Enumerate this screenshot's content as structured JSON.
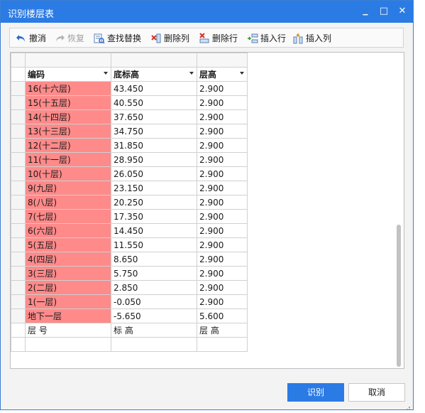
{
  "window": {
    "title": "识别楼层表",
    "minimize_glyph": "▁",
    "maximize_glyph": "□",
    "close_glyph": "✕"
  },
  "toolbar": {
    "undo": "撤消",
    "redo": "恢复",
    "find_replace": "查找替换",
    "delete_col": "删除列",
    "delete_row": "删除行",
    "insert_row": "插入行",
    "insert_col": "插入列"
  },
  "grid": {
    "headers": [
      "编码",
      "底标高",
      "层高"
    ],
    "rows": [
      {
        "code": "16(十六层)",
        "elev": "43.450",
        "height": "2.900"
      },
      {
        "code": "15(十五层)",
        "elev": "40.550",
        "height": "2.900"
      },
      {
        "code": "14(十四层)",
        "elev": "37.650",
        "height": "2.900"
      },
      {
        "code": "13(十三层)",
        "elev": "34.750",
        "height": "2.900"
      },
      {
        "code": "12(十二层)",
        "elev": "31.850",
        "height": "2.900"
      },
      {
        "code": "11(十一层)",
        "elev": "28.950",
        "height": "2.900"
      },
      {
        "code": "10(十层)",
        "elev": "26.050",
        "height": "2.900"
      },
      {
        "code": "9(九层)",
        "elev": "23.150",
        "height": "2.900"
      },
      {
        "code": "8(八层)",
        "elev": "20.250",
        "height": "2.900"
      },
      {
        "code": "7(七层)",
        "elev": "17.350",
        "height": "2.900"
      },
      {
        "code": "6(六层)",
        "elev": "14.450",
        "height": "2.900"
      },
      {
        "code": "5(五层)",
        "elev": "11.550",
        "height": "2.900"
      },
      {
        "code": "4(四层)",
        "elev": "8.650",
        "height": "2.900"
      },
      {
        "code": "3(三层)",
        "elev": "5.750",
        "height": "2.900"
      },
      {
        "code": "2(二层)",
        "elev": "2.850",
        "height": "2.900"
      },
      {
        "code": "1(一层)",
        "elev": "-0.050",
        "height": "2.900"
      },
      {
        "code": "地下一层",
        "elev": "-5.650",
        "height": "5.600"
      }
    ],
    "footer": [
      "层 号",
      "标  高",
      "层 高"
    ],
    "highlight_color": "#ff8a8a"
  },
  "buttons": {
    "ok": "识别",
    "cancel": "取消"
  },
  "colors": {
    "title_bar": "#2b7be4",
    "primary_button": "#2b7be4"
  }
}
